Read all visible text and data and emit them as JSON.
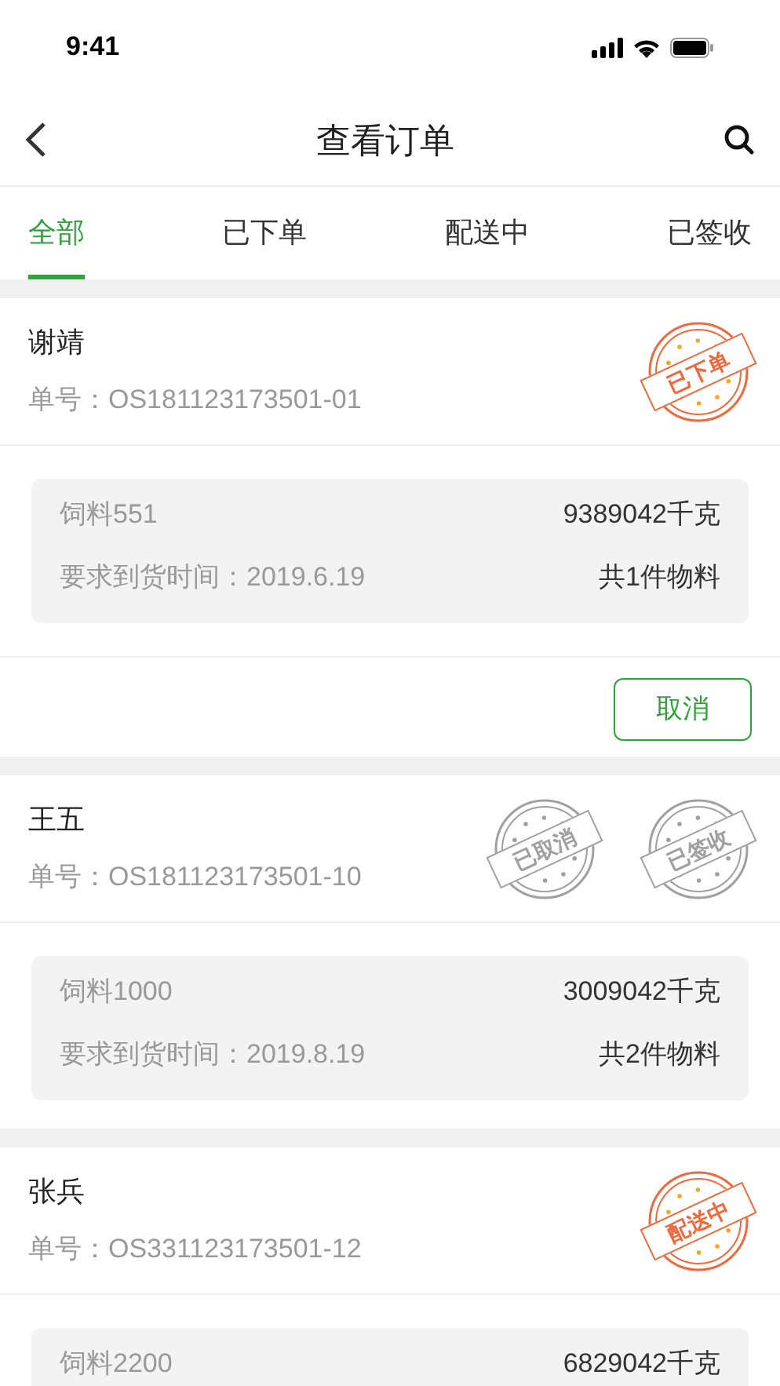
{
  "status_bar": {
    "time": "9:41"
  },
  "nav": {
    "title": "查看订单"
  },
  "tabs": [
    {
      "label": "全部",
      "selected": true
    },
    {
      "label": "已下单",
      "selected": false
    },
    {
      "label": "配送中",
      "selected": false
    },
    {
      "label": "已签收",
      "selected": false
    }
  ],
  "orders": [
    {
      "customer": "谢靖",
      "order_no": "单号：OS181123173501-01",
      "stamps": [
        {
          "kind": "active",
          "text": "已下单"
        }
      ],
      "item": "饲料551",
      "weight": "9389042千克",
      "delivery": "要求到货时间：2019.6.19",
      "count": "共1件物料",
      "action": "取消"
    },
    {
      "customer": "王五",
      "order_no": "单号：OS181123173501-10",
      "stamps": [
        {
          "kind": "inactive",
          "text": "已取消"
        },
        {
          "kind": "inactive",
          "text": "已签收"
        }
      ],
      "item": "饲料1000",
      "weight": "3009042千克",
      "delivery": "要求到货时间：2019.8.19",
      "count": "共2件物料"
    },
    {
      "customer": "张兵",
      "order_no": "单号：OS331123173501-12",
      "stamps": [
        {
          "kind": "active",
          "text": "配送中"
        }
      ],
      "item": "饲料2200",
      "weight": "6829042千克"
    }
  ]
}
